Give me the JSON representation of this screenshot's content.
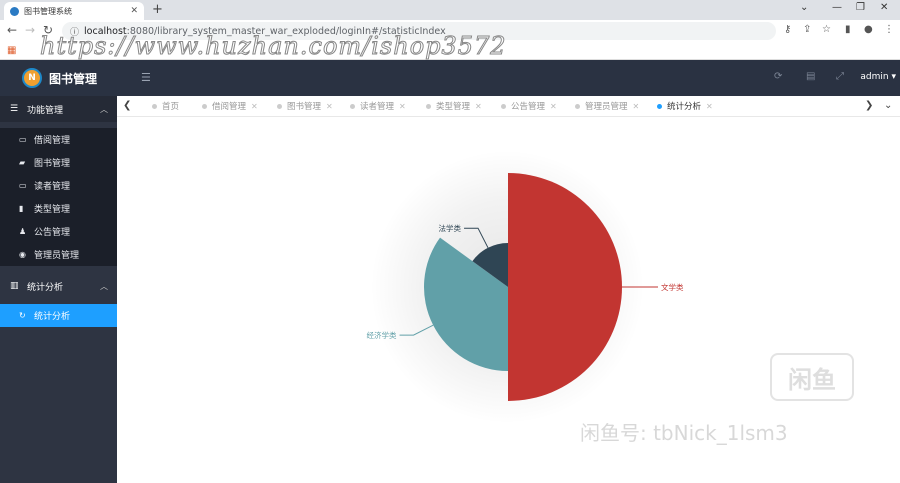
{
  "browser": {
    "tab_title": "图书管理系统",
    "url_host": "localhost",
    "url_rest": ":8080/library_system_master_war_exploded/loginIn#/statisticIndex",
    "watermark": "https://www.huzhan.com/ishop3572"
  },
  "header": {
    "brand": "图书管理",
    "user": "admin"
  },
  "sidebar": {
    "groups": [
      {
        "label": "功能管理",
        "items": [
          {
            "label": "借阅管理"
          },
          {
            "label": "图书管理"
          },
          {
            "label": "读者管理"
          },
          {
            "label": "类型管理"
          },
          {
            "label": "公告管理"
          },
          {
            "label": "管理员管理"
          }
        ]
      },
      {
        "label": "统计分析",
        "items": [
          {
            "label": "统计分析"
          }
        ]
      }
    ]
  },
  "tabs": [
    {
      "label": "首页"
    },
    {
      "label": "借阅管理"
    },
    {
      "label": "图书管理"
    },
    {
      "label": "读者管理"
    },
    {
      "label": "类型管理"
    },
    {
      "label": "公告管理"
    },
    {
      "label": "管理员管理"
    },
    {
      "label": "统计分析"
    }
  ],
  "chart_data": {
    "type": "pie",
    "variant": "rose",
    "categories": [
      "文学类",
      "经济学类",
      "法学类"
    ],
    "values": [
      10,
      7,
      3
    ],
    "colors": [
      "#c23531",
      "#61a0a8",
      "#2f4554"
    ]
  },
  "overlay": {
    "logo_text": "闲鱼",
    "text": "闲鱼号: tbNick_1lsm3"
  }
}
